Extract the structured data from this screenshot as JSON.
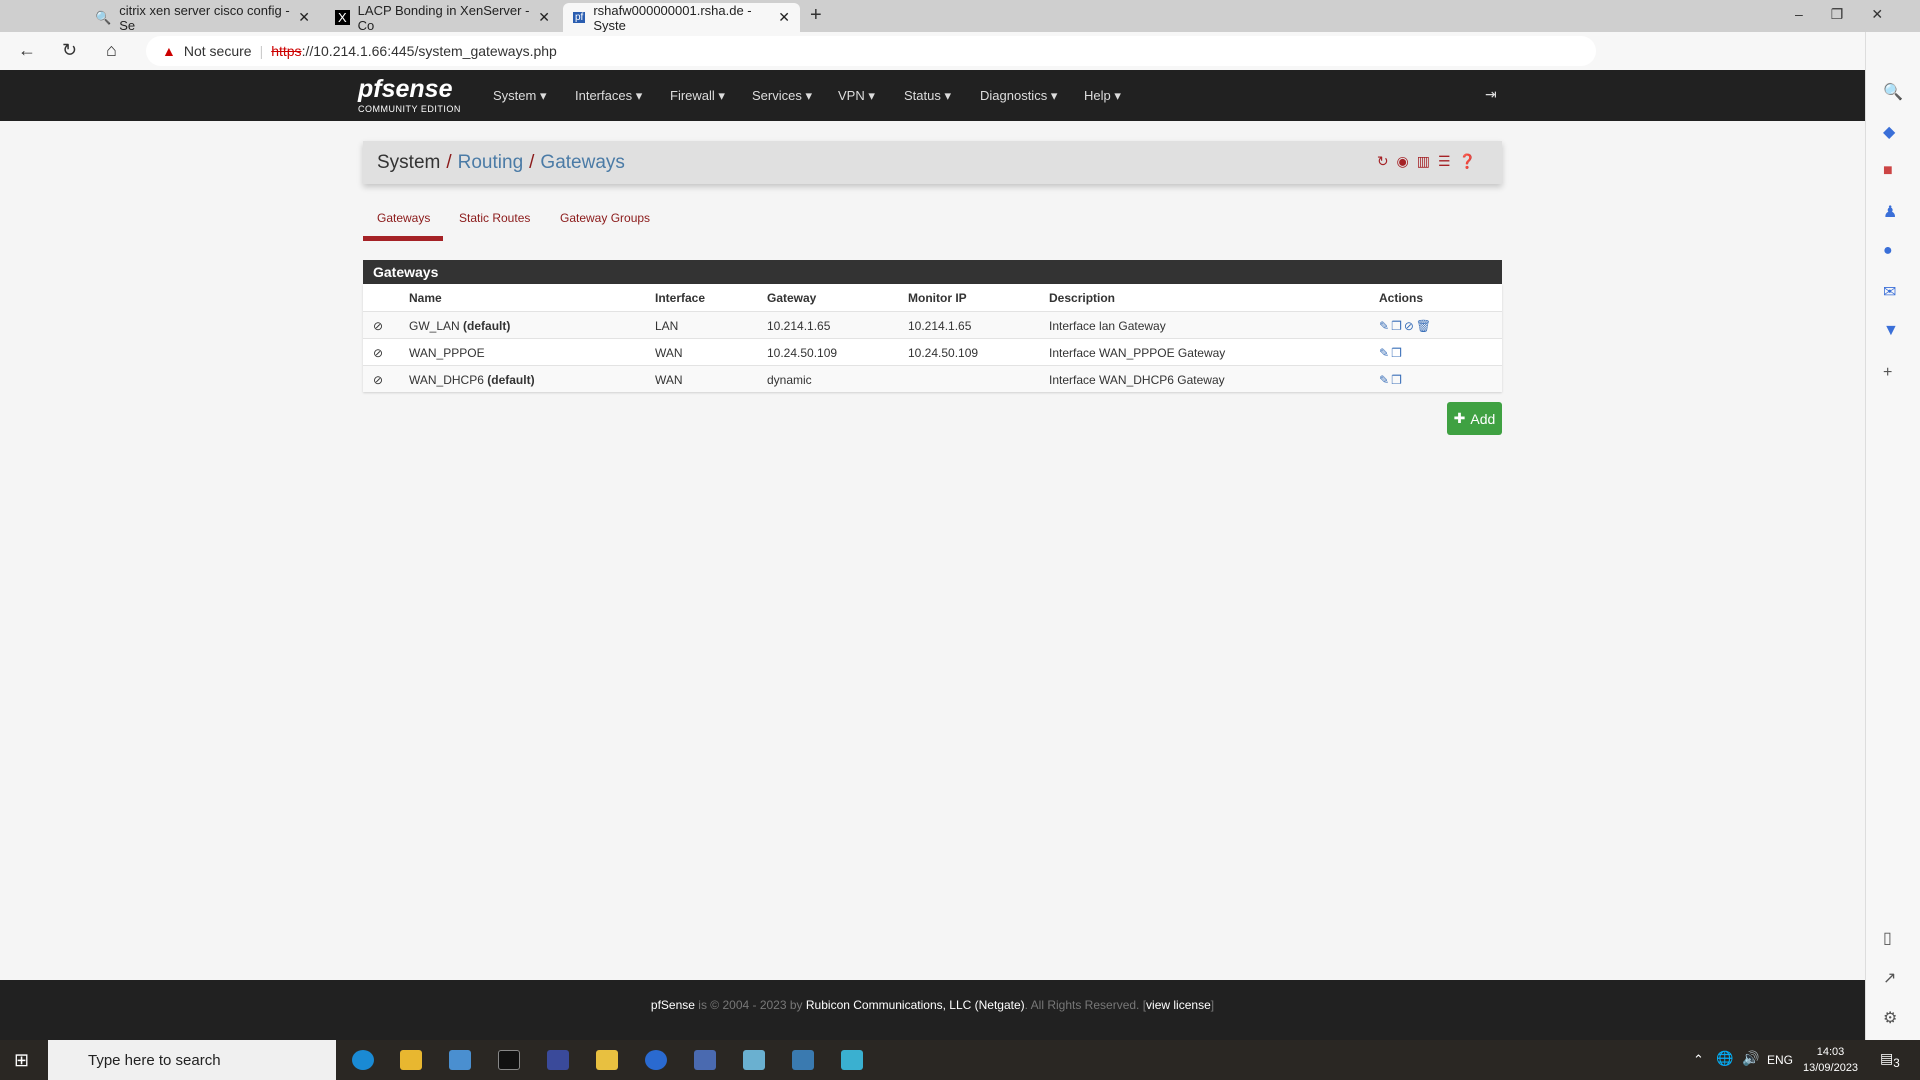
{
  "browser": {
    "tabs": [
      {
        "label": "citrix xen server cisco config - Se",
        "icon": "search-icon"
      },
      {
        "label": "LACP Bonding in XenServer - Co",
        "icon": "x-logo-icon"
      },
      {
        "label": "rshafw000000001.rsha.de - Syste",
        "icon": "pfsense-favicon-icon"
      }
    ],
    "security": "Not secure",
    "url_scheme": "https",
    "url_rest": "://10.214.1.66:445/system_gateways.php"
  },
  "nav": {
    "logo": "pfsense",
    "logo_sub": "COMMUNITY EDITION",
    "items": [
      "System",
      "Interfaces",
      "Firewall",
      "Services",
      "VPN",
      "Status",
      "Diagnostics",
      "Help"
    ]
  },
  "breadcrumb": {
    "root": "System",
    "mid": "Routing",
    "current": "Gateways"
  },
  "tabs": [
    "Gateways",
    "Static Routes",
    "Gateway Groups"
  ],
  "panel": {
    "title": "Gateways",
    "columns": [
      "Name",
      "Interface",
      "Gateway",
      "Monitor IP",
      "Description",
      "Actions"
    ],
    "rows": [
      {
        "name": "GW_LAN",
        "default": "(default)",
        "interface": "LAN",
        "gateway": "10.214.1.65",
        "monitor": "10.214.1.65",
        "description": "Interface lan Gateway",
        "actions": [
          "edit",
          "copy",
          "disable",
          "delete"
        ]
      },
      {
        "name": "WAN_PPPOE",
        "default": "",
        "interface": "WAN",
        "gateway": "10.24.50.109",
        "monitor": "10.24.50.109",
        "description": "Interface WAN_PPPOE Gateway",
        "actions": [
          "edit",
          "copy"
        ]
      },
      {
        "name": "WAN_DHCP6",
        "default": "(default)",
        "interface": "WAN",
        "gateway": "dynamic",
        "monitor": "",
        "description": "Interface WAN_DHCP6 Gateway",
        "actions": [
          "edit",
          "copy"
        ]
      }
    ]
  },
  "add_label": "Add",
  "footer": {
    "brand": "pfSense",
    "is": "is © 2004 - 2023 by",
    "company": "Rubicon Communications, LLC (Netgate)",
    "rights": ". All Rights Reserved. [",
    "license": "view license",
    "close": "]"
  },
  "taskbar": {
    "search_placeholder": "Type here to search",
    "lang": "ENG",
    "time": "14:03",
    "date": "13/09/2023",
    "notifications": "3"
  },
  "colors": {
    "accent": "#a52226",
    "link": "#4b7ba6",
    "add": "#3fa142"
  }
}
